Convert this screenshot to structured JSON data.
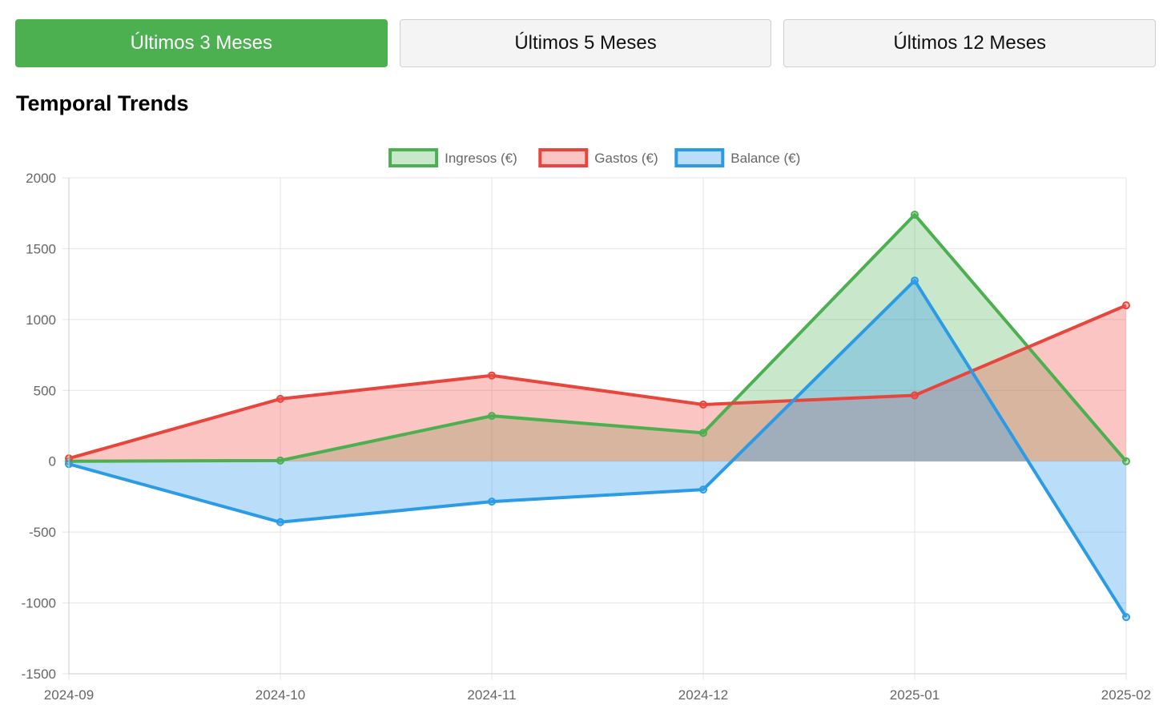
{
  "range_buttons": [
    {
      "label": "Últimos 3 Meses",
      "active": true
    },
    {
      "label": "Últimos 5 Meses",
      "active": false
    },
    {
      "label": "Últimos 12 Meses",
      "active": false
    }
  ],
  "section_title": "Temporal Trends",
  "colors": {
    "active_button": "#4caf50",
    "ingresos": "#4caf50",
    "gastos": "#e8453c",
    "balance": "#2b9be6"
  },
  "chart_data": {
    "type": "area",
    "title": "",
    "xlabel": "",
    "ylabel": "",
    "categories": [
      "2024-09",
      "2024-10",
      "2024-11",
      "2024-12",
      "2025-01",
      "2025-02"
    ],
    "ylim": [
      -1500,
      2000
    ],
    "yticks": [
      2000,
      1500,
      1000,
      500,
      0,
      -500,
      -1000,
      -1500
    ],
    "grid": true,
    "legend_position": "top-center",
    "series": [
      {
        "name": "Ingresos (€)",
        "color": "#4caf50",
        "fill": "rgba(76,175,80,0.30)",
        "values": [
          0,
          5,
          320,
          200,
          1740,
          0
        ]
      },
      {
        "name": "Gastos (€)",
        "color": "#e8453c",
        "fill": "rgba(240,90,80,0.35)",
        "values": [
          20,
          440,
          605,
          400,
          465,
          1100
        ]
      },
      {
        "name": "Balance (€)",
        "color": "#2b9be6",
        "fill": "rgba(56,160,240,0.35)",
        "values": [
          -20,
          -430,
          -285,
          -200,
          1275,
          -1100
        ]
      }
    ]
  }
}
